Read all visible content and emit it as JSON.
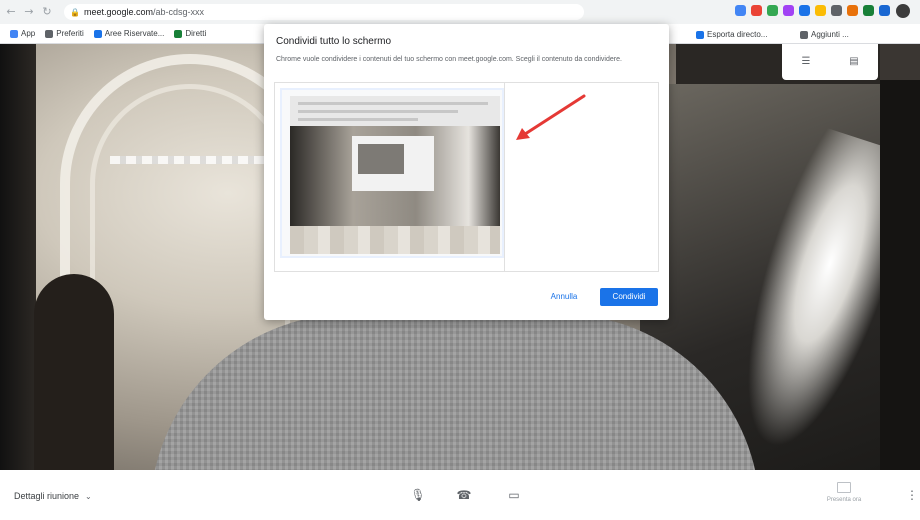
{
  "browser": {
    "address_host": "meet.google.com",
    "address_path": "/ab-cdsg-xxx",
    "nav": [
      "←",
      "→",
      "↻"
    ],
    "extension_colors": [
      "#4285f4",
      "#ea4335",
      "#34a853",
      "#a142f4",
      "#1a73e8",
      "#fbbc04",
      "#5f6368",
      "#e8710a",
      "#188038",
      "#1967d2"
    ]
  },
  "bookmarks": {
    "items": [
      {
        "label": "App",
        "icon_color": "#4285f4"
      },
      {
        "label": "Preferiti",
        "icon_color": "#5f6368"
      },
      {
        "label": "Aree Riservate...",
        "icon_color": "#1a73e8"
      },
      {
        "label": "Diretti",
        "icon_color": "#188038"
      }
    ],
    "right_items": [
      {
        "label": "Esporta directo...",
        "icon_color": "#1a73e8"
      },
      {
        "label": "Aggiunti ...",
        "icon_color": "#5f6368"
      }
    ]
  },
  "dialog": {
    "title": "Condividi tutto lo schermo",
    "description": "Chrome vuole condividere i contenuti del tuo schermo con meet.google.com. Scegli il contenuto da condividere.",
    "cancel_label": "Annulla",
    "share_label": "Condividi"
  },
  "bottom_bar": {
    "meeting_details_label": "Dettagli riunione",
    "chevron": "⌄",
    "mic_icon": "🎙",
    "hangup_icon": "☎",
    "camera_icon": "▭",
    "present_now_label": "Presenta ora",
    "more_icon": "⋮"
  },
  "colors": {
    "accent": "#1a73e8",
    "arrow": "#e53935"
  }
}
